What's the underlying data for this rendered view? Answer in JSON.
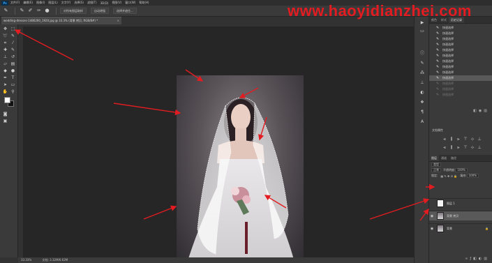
{
  "app": {
    "logo": "Ps"
  },
  "menu": {
    "items": [
      "文件(F)",
      "编辑(E)",
      "图像(I)",
      "图层(L)",
      "文字(Y)",
      "选择(S)",
      "滤镜(T)",
      "3D(D)",
      "视图(V)",
      "窗口(W)",
      "帮助(H)"
    ]
  },
  "options_bar": {
    "tool_icons": [
      "brush-icon",
      "brush-add-icon",
      "brush-subtract-icon",
      "brush-size-icon"
    ],
    "sample_all_layers": "对所有图层取样",
    "auto_enhance": "自动增强",
    "select_and_mask": "选择并遮住..."
  },
  "watermark": {
    "text": "www.haoyidianzhei.com",
    "color": "#e21c21"
  },
  "document": {
    "tab_title": "wedding-dresses-1486260_1920.jpg @ 33.3% (背景 拷贝, RGB/8#) *",
    "close_glyph": "×"
  },
  "status_bar": {
    "zoom": "33.33%",
    "doc_size": "文档: 3.32M/6.62M"
  },
  "panels": {
    "history_tabs": [
      "颜色",
      "样式",
      "历史记录"
    ],
    "history_items": [
      "快速选择",
      "快速选择",
      "快速选择",
      "快速选择",
      "快速选择",
      "快速选择",
      "快速选择",
      "快速选择",
      "快速选择",
      "快速选择",
      "快速选择",
      "快速选择",
      "快速选择"
    ],
    "history_selected_index": 9,
    "history_dim_from_index": 10,
    "properties_title": "文档属性",
    "layers_tabs": [
      "图层",
      "通道",
      "路径"
    ],
    "kind_filter": "类型",
    "blend_mode": "正常",
    "opacity_label": "不透明度:",
    "opacity_value": "100%",
    "lock_label": "锁定:",
    "fill_label": "填充:",
    "fill_value": "100%",
    "layers": [
      {
        "name": "图层 1",
        "visible": false,
        "selected": false,
        "thumb": "white",
        "locked": false
      },
      {
        "name": "背景 拷贝",
        "visible": true,
        "selected": true,
        "thumb": "photo",
        "locked": false
      },
      {
        "name": "背景",
        "visible": true,
        "selected": false,
        "thumb": "photo",
        "locked": true
      }
    ]
  },
  "colors": {
    "accent_annotation": "#e21c21",
    "foreground_swatch": "#ffffff",
    "background_swatch": "#111111"
  }
}
